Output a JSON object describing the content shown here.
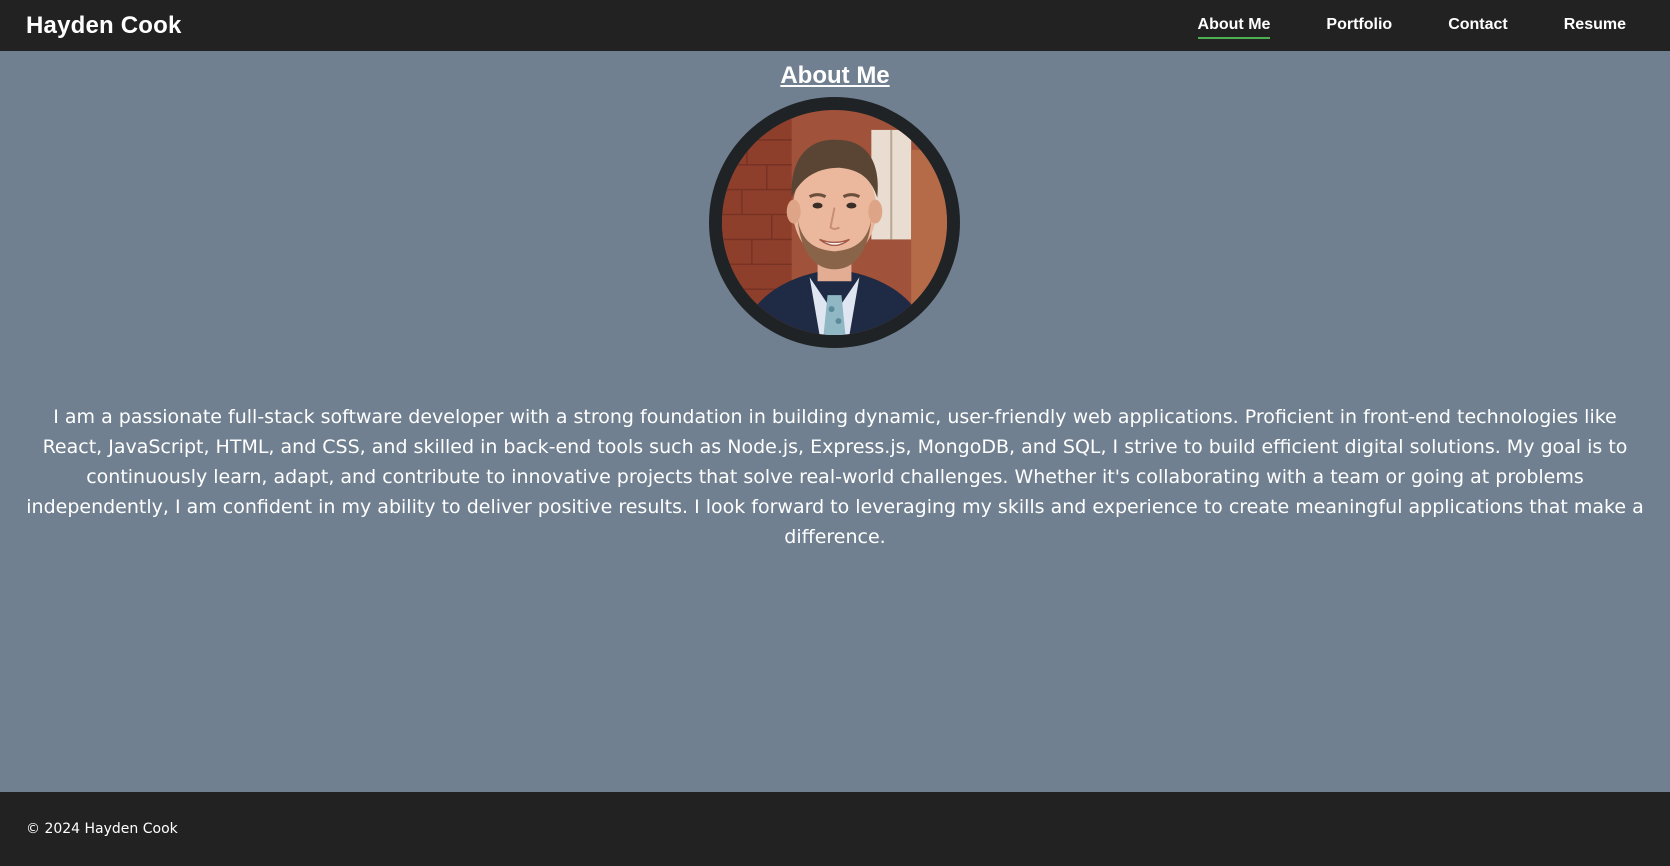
{
  "navbar": {
    "brand": "Hayden Cook",
    "links": [
      {
        "label": "About Me",
        "active": true
      },
      {
        "label": "Portfolio",
        "active": false
      },
      {
        "label": "Contact",
        "active": false
      },
      {
        "label": "Resume",
        "active": false
      }
    ],
    "active_underline_color": "#4caf50"
  },
  "main": {
    "title": "About Me",
    "bio": "I am a passionate full-stack software developer with a strong foundation in building dynamic, user-friendly web applications. Proficient in front-end technologies like React, JavaScript, HTML, and CSS, and skilled in back-end tools such as Node.js, Express.js, MongoDB, and SQL, I strive to build efficient digital solutions. My goal is to continuously learn, adapt, and contribute to innovative projects that solve real-world challenges. Whether it's collaborating with a team or going at problems independently, I am confident in my ability to deliver positive results. I look forward to leveraging my skills and experience to create meaningful applications that make a difference."
  },
  "footer": {
    "copyright": "© 2024 Hayden Cook"
  },
  "colors": {
    "background": "#708090",
    "navbar": "#222222",
    "footer": "#222222",
    "text": "#ffffff"
  }
}
